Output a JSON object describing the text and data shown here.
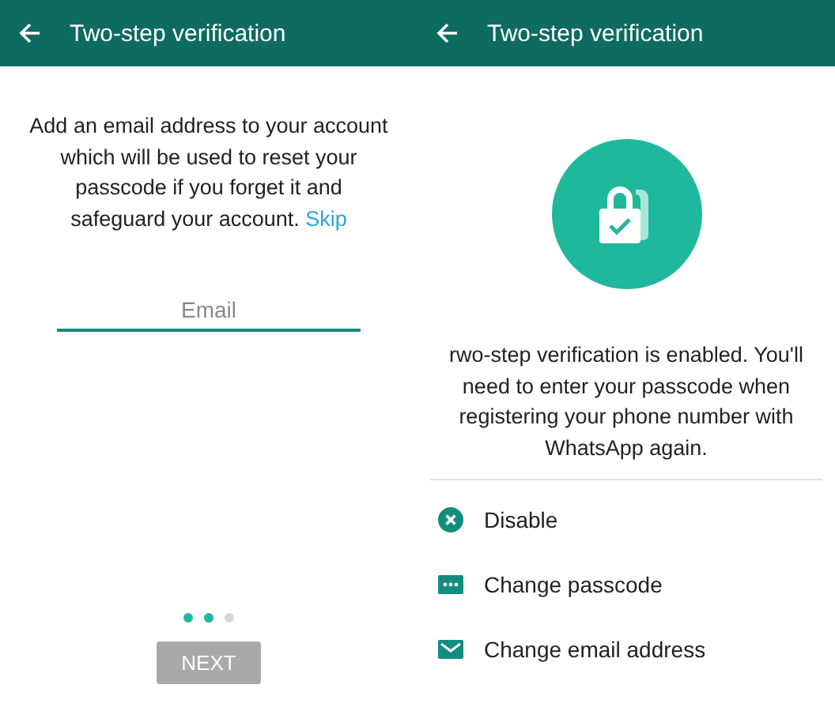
{
  "screens": [
    {
      "kind": "email",
      "title": "Two-step verification",
      "message": "Add an email address to your account which will be used to reset your passcode if you forget it and safeguard your account.",
      "link": "Skip",
      "email_field": {
        "placeholder": "Email"
      },
      "dots": [
        {
          "filled": true
        },
        {
          "filled": true
        },
        {
          "filled": false
        }
      ],
      "button": {
        "label": "NEXT",
        "disabled": true
      }
    },
    {
      "kind": "done",
      "title": "Two-step verification",
      "message": "rwo-step verification is enabled. You'll need to enter your passcode when registering your phone number with WhatsApp again.",
      "options": [
        {
          "kind": "disable",
          "label": "Disable"
        },
        {
          "kind": "passcode",
          "label": "Change passcode"
        },
        {
          "kind": "email",
          "label": "Change email address"
        }
      ]
    }
  ]
}
